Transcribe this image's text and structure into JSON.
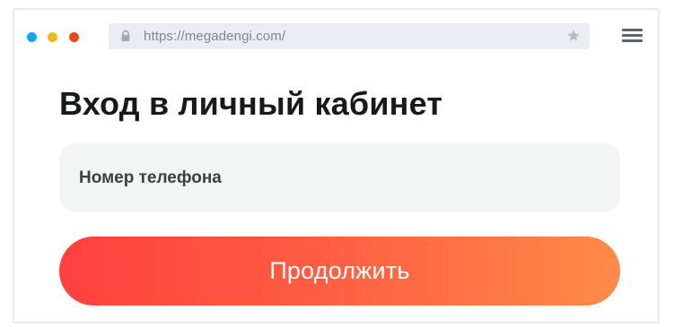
{
  "browser": {
    "url": "https://megadengi.com/",
    "window_dots": [
      {
        "name": "blue",
        "color": "#12a6ee"
      },
      {
        "name": "yellow",
        "color": "#f5b717"
      },
      {
        "name": "red",
        "color": "#e8471c"
      }
    ],
    "icons": {
      "lock": "lock-icon",
      "bookmark": "star-icon",
      "menu": "hamburger-menu-icon"
    }
  },
  "login": {
    "title": "Вход в личный кабинет",
    "phone_placeholder": "Номер телефона",
    "phone_value": "",
    "continue_label": "Продолжить"
  },
  "colors": {
    "button_gradient_start": "#ff4040",
    "button_gradient_end": "#ff8a4a",
    "field_background": "#f3f5f5",
    "title_color": "#17191c"
  }
}
